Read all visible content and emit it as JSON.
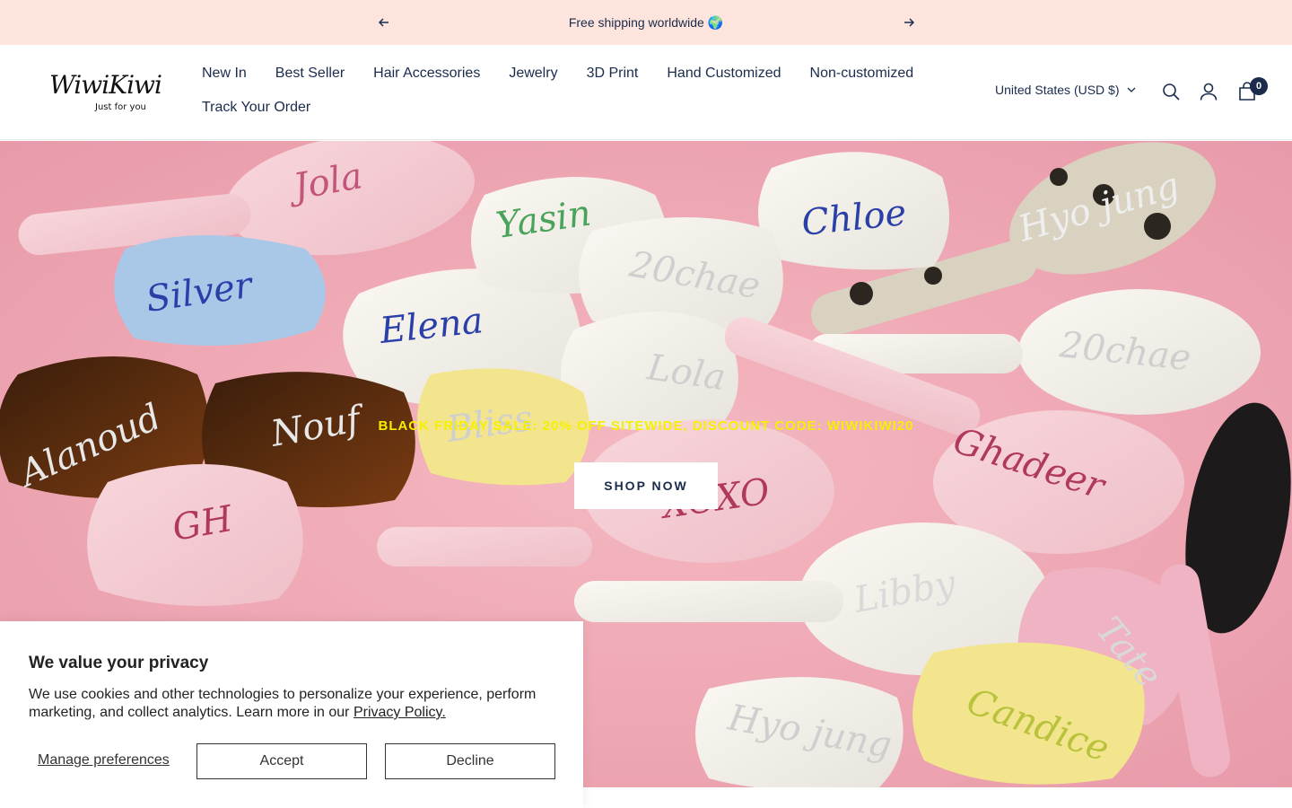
{
  "announcement": {
    "text": "Free shipping worldwide 🌍"
  },
  "logo": {
    "brand": "WiwiKiwi",
    "tagline": "Just for you"
  },
  "nav": {
    "items": [
      "New In",
      "Best Seller",
      "Hair Accessories",
      "Jewelry",
      "3D Print",
      "Hand Customized",
      "Non-customized",
      "Track Your Order"
    ]
  },
  "header": {
    "country": "United States (USD $)",
    "cart_count": "0"
  },
  "hero": {
    "promo": "BLACK FRIDAY SALE: 20% OFF SITEWIDE, DISCOUNT CODE: WIWIKIWI20",
    "cta": "SHOP NOW",
    "names": [
      "Jola",
      "Yasin",
      "Chloe",
      "Hyo jung",
      "Silver",
      "Elena",
      "20chae",
      "20chae",
      "Lola",
      "Alanoud",
      "Nouf",
      "Bliss",
      "Ghadeer",
      "XOXO",
      "GH",
      "Libby",
      "Hyo jung",
      "Candice",
      "Tate"
    ]
  },
  "cookie": {
    "title": "We value your privacy",
    "body": "We use cookies and other technologies to personalize your experience, perform marketing, and collect analytics. Learn more in our ",
    "link": "Privacy Policy.",
    "manage": "Manage preferences",
    "accept": "Accept",
    "decline": "Decline"
  },
  "colors": {
    "announce_bg": "#fde4dc",
    "navy": "#1a2b4c",
    "promo": "#f5f000",
    "hero_bg": "#eea6b3"
  }
}
